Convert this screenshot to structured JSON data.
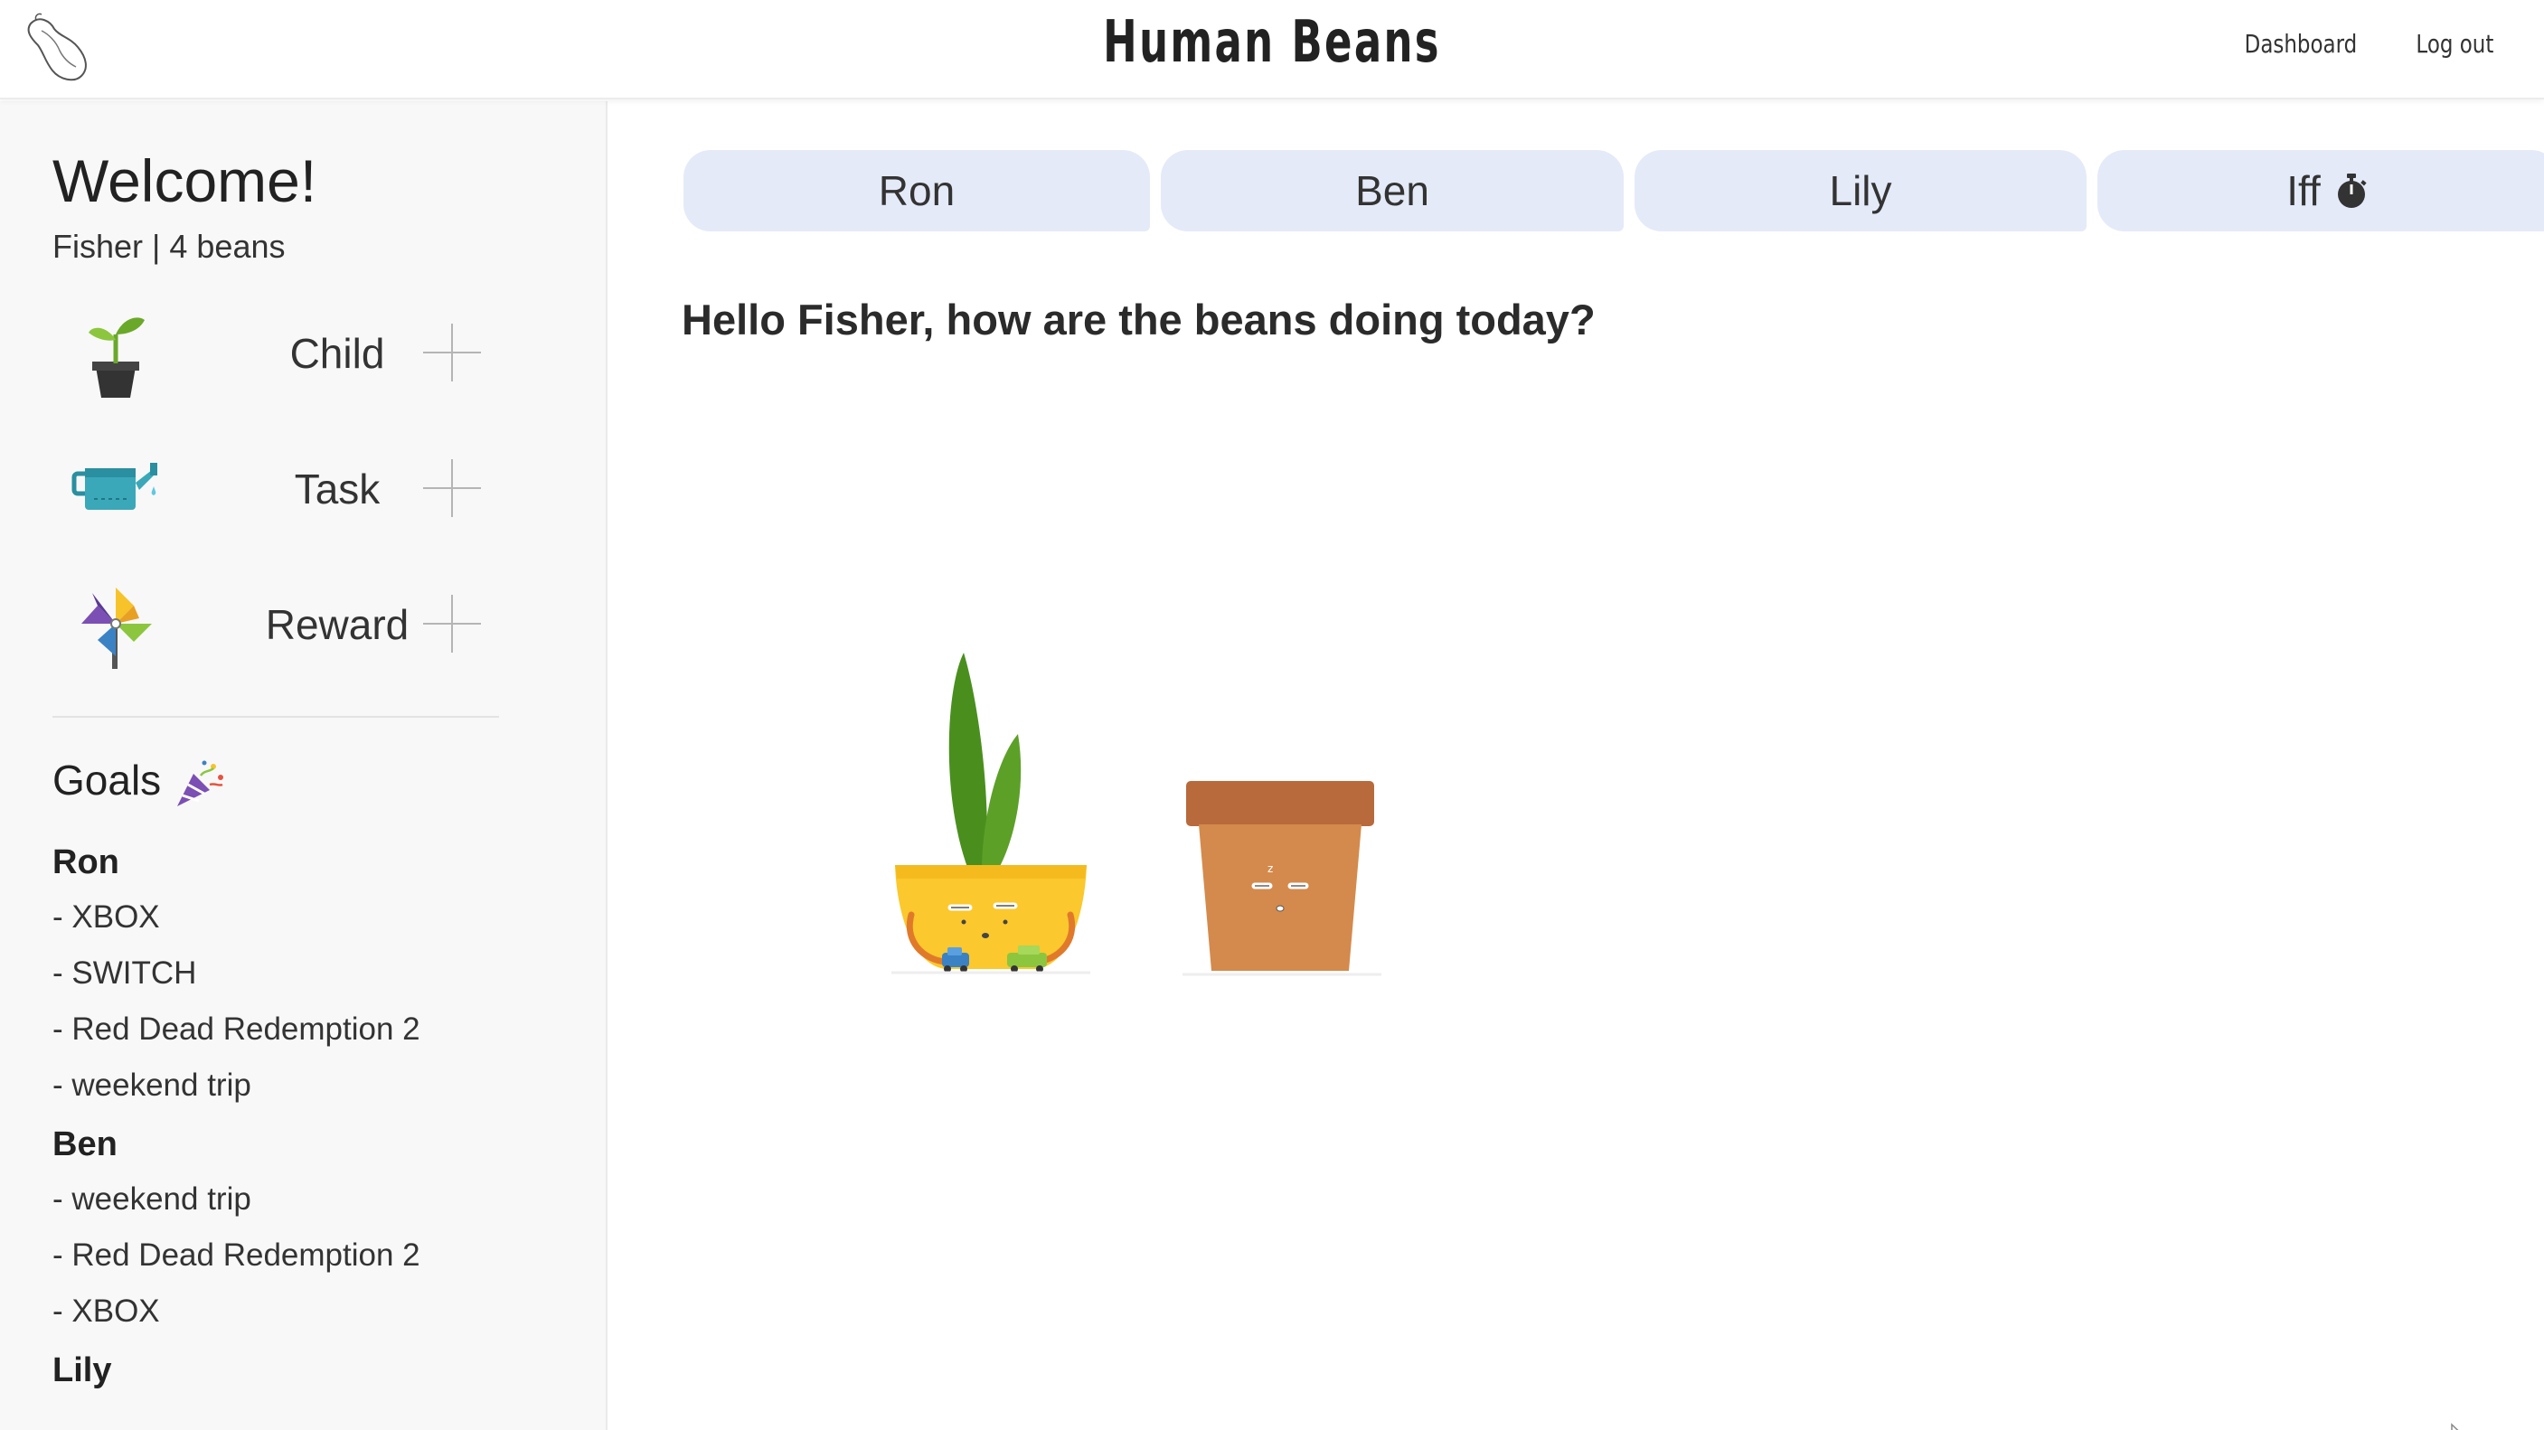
{
  "header": {
    "title": "Human Beans",
    "nav": {
      "dashboard": "Dashboard",
      "logout": "Log out"
    }
  },
  "sidebar": {
    "welcome": "Welcome!",
    "user_info": "Fisher | 4 beans",
    "add_items": [
      {
        "label": "Child",
        "icon": "seedling-pot-icon"
      },
      {
        "label": "Task",
        "icon": "watering-can-icon"
      },
      {
        "label": "Reward",
        "icon": "pinwheel-icon"
      }
    ],
    "goals_title": "Goals",
    "goals_icon": "party-popper-icon",
    "goals": [
      {
        "child": "Ron",
        "items": [
          "- XBOX",
          "- SWITCH",
          "- Red Dead Redemption 2",
          "- weekend trip"
        ]
      },
      {
        "child": "Ben",
        "items": [
          "- weekend trip",
          "- Red Dead Redemption 2",
          "- XBOX"
        ]
      },
      {
        "child": "Lily",
        "items": []
      }
    ]
  },
  "main": {
    "tabs": [
      {
        "label": "Ron"
      },
      {
        "label": "Ben"
      },
      {
        "label": "Lily"
      },
      {
        "label": "Iff",
        "icon": "stopwatch-icon"
      }
    ],
    "greeting": "Hello Fisher, how are the beans doing today?"
  },
  "colors": {
    "tab_bg": "#e4eaf8",
    "sidebar_bg": "#f8f8f8",
    "yellow_pot": "#fbc82d",
    "terracotta_pot": "#d48a4c",
    "terracotta_rim": "#b86a3c",
    "leaf": "#4a8f1e"
  }
}
